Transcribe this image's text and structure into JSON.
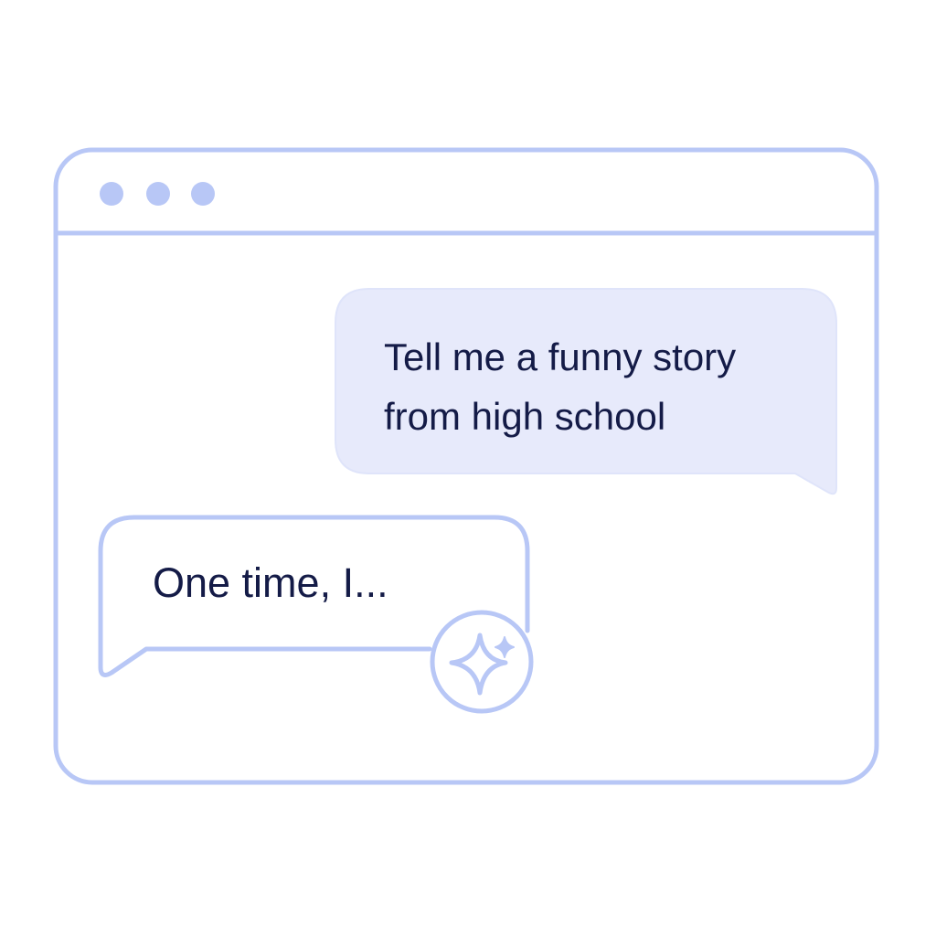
{
  "window": {
    "controls": [
      "dot",
      "dot",
      "dot"
    ]
  },
  "messages": [
    {
      "role": "user",
      "lines": [
        "Tell me a funny story",
        "from high school"
      ]
    },
    {
      "role": "assistant",
      "text": "One time, I..."
    }
  ],
  "assistant_badge": {
    "icon": "sparkle-icon"
  },
  "colors": {
    "outline": "#b8c7f6",
    "user_bubble": "#e7eafb",
    "text": "#141b47"
  }
}
